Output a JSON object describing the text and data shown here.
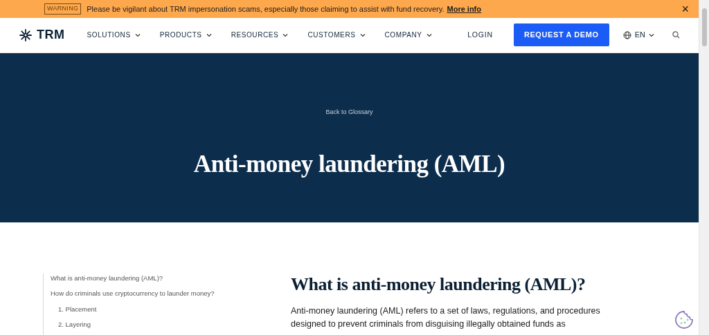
{
  "banner": {
    "tag": "WARNING",
    "message": "Please be vigilant about TRM impersonation scams, especially those claiming to assist with fund recovery.",
    "link": "More info",
    "close": "×"
  },
  "navbar": {
    "logo": "TRM",
    "menu": [
      {
        "label": "SOLUTIONS",
        "dropdown": true
      },
      {
        "label": "PRODUCTS",
        "dropdown": true
      },
      {
        "label": "RESOURCES",
        "dropdown": true
      },
      {
        "label": "CUSTOMERS",
        "dropdown": true
      },
      {
        "label": "COMPANY",
        "dropdown": true
      }
    ],
    "login": "LOGIN",
    "cta": "REQUEST A DEMO",
    "language": "EN"
  },
  "hero": {
    "back_link": "Back to Glossary",
    "title": "Anti-money laundering (AML)"
  },
  "toc": [
    {
      "label": "What is anti-money laundering (AML)?"
    },
    {
      "label": "How do criminals use cryptocurrency to launder money?",
      "children": [
        {
          "label": "1. Placement"
        },
        {
          "label": "2. Layering"
        }
      ]
    }
  ],
  "article": {
    "heading": "What is anti-money laundering (AML)?",
    "paragraph": "Anti-money laundering (AML) refers to a set of laws, regulations, and procedures designed to prevent criminals from disguising illegally obtained funds as"
  }
}
